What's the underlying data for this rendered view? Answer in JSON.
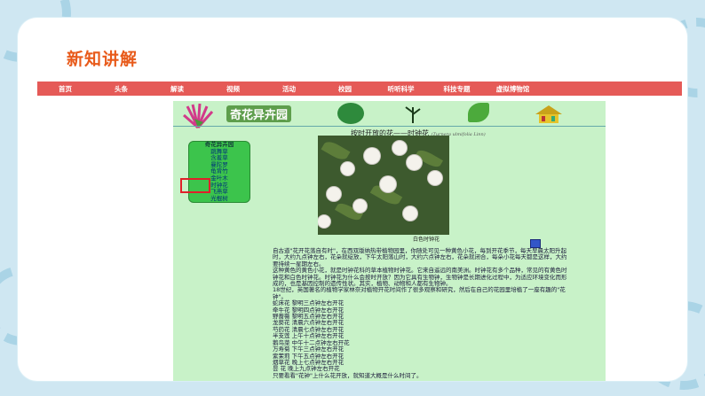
{
  "slide_title": "新知讲解",
  "nav": [
    "首页",
    "头条",
    "解读",
    "视频",
    "活动",
    "校园",
    "听听科学",
    "科技专题",
    "虚拟博物馆"
  ],
  "site": {
    "logo_text": "奇花异卉园",
    "menu": [
      "奇花异卉园",
      "跳舞草",
      "含羞草",
      "曼陀罗",
      "龟背竹",
      "金叶木",
      "时钟花",
      "飞燕草",
      "光棍树"
    ],
    "page_title": "按时开放的花——时钟花",
    "latin": "(Turnera ulmifolia Linn)",
    "caption": "白色时钟花",
    "paragraphs": [
      "自古道\"花开花落自有时\"，在西双版纳热带植物园里，你随处可见一种黄色小花，每到开花季节，每天早晨太阳升起时，大约九点钟左右，花朵就绽放，下午太阳落山时，大约六点钟左右，花朵就闭合，每朵小花每天都是这样，大约要持续一星期左右。",
      "这种黄色的黄色小花，就是时钟花科的草本植物时钟花。它来自遥远的南美洲。时钟花有多个品种，常见的有黄色时钟花和白色时钟花。时钟花为什么会按时开放？因为它具有生物钟，生物钟是长期进化过程中，为适应环境变化而形成的，也是基因控制的遗传性状。其实，植物、动物和人都有生物钟。",
      "18世纪，英国著名的植物学家林奈对植物开花时间作了很多观察和研究，然后在自己的花园里培植了一座有趣的\"花钟\"。"
    ],
    "schedule": [
      "蛇床花 黎明三点钟左右开花",
      "牵牛花 黎明四点钟左右开花",
      "野蔷薇 黎明五点钟左右开花",
      "龙葵花 清晨六点钟左右开花",
      "芍药花 清晨七点钟左右开花",
      "半支莲 上午十点钟左右开花",
      "鹅鸟菜 中午十二点钟左右开花",
      "万寿菊 下午三点钟左右开花",
      "紫茉莉 下午五点钟左右开花",
      "烟草花 晚上七点钟左右开花",
      "昙 花 晚上九点钟左右开花"
    ],
    "footer": "只要看看\"花钟\"上什么花开放，就知道大概是什么时间了。"
  }
}
